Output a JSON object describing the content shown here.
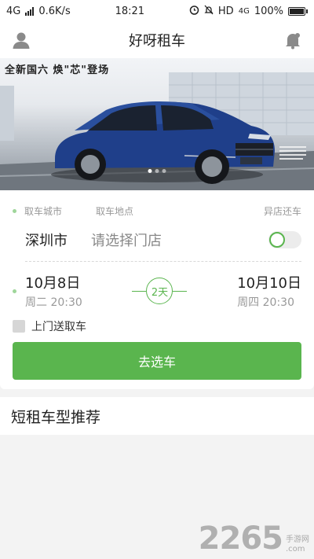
{
  "status_bar": {
    "network": "4G",
    "speed": "0.6K/s",
    "time": "18:21",
    "hd": "HD",
    "network_right": "4G",
    "battery": "100%"
  },
  "header": {
    "title": "好呀租车",
    "left_icon": "user-icon",
    "right_icon": "notification-icon"
  },
  "banner": {
    "slogan": "全新国六 焕\"芯\"登场",
    "slides": 3,
    "active_slide": 0
  },
  "booking": {
    "pickup_city_label": "取车城市",
    "pickup_location_label": "取车地点",
    "return_elsewhere_label": "异店还车",
    "city": "深圳市",
    "store_placeholder": "请选择门店",
    "return_elsewhere_enabled": false,
    "pickup_date": "10月8日",
    "pickup_weekday_time": "周二  20:30",
    "duration": "2天",
    "return_date": "10月10日",
    "return_weekday_time": "周四  20:30",
    "delivery_label": "上门送取车",
    "delivery_checked": false,
    "submit_label": "去选车"
  },
  "recommend": {
    "title": "短租车型推荐"
  },
  "watermark": {
    "big": "2265",
    "small_top": "手游网",
    "small_bottom": ".com"
  },
  "colors": {
    "accent": "#5ab54e",
    "car_body": "#1f3f8a"
  }
}
